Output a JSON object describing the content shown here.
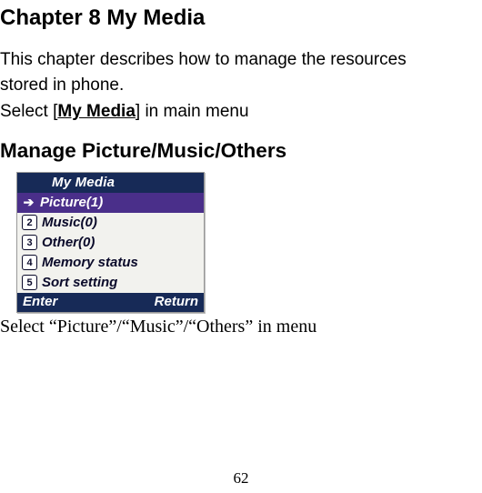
{
  "chapter_title": "Chapter 8 My Media",
  "intro_line1": "This chapter describes how to manage the resources",
  "intro_line2": "stored in phone.",
  "select_prefix": "Select [",
  "select_bold": "My Media",
  "select_suffix": "] in main menu",
  "section_title": "Manage Picture/Music/Others",
  "phone": {
    "title": "My Media",
    "items": [
      {
        "num": "",
        "label": "Picture(1)",
        "selected": true
      },
      {
        "num": "2",
        "label": "Music(0)",
        "selected": false
      },
      {
        "num": "3",
        "label": "Other(0)",
        "selected": false
      },
      {
        "num": "4",
        "label": "Memory status",
        "selected": false
      },
      {
        "num": "5",
        "label": "Sort setting",
        "selected": false
      }
    ],
    "soft_left": "Enter",
    "soft_right": "Return"
  },
  "caption": "Select “Picture”/“Music”/“Others” in menu",
  "page_number": "62"
}
